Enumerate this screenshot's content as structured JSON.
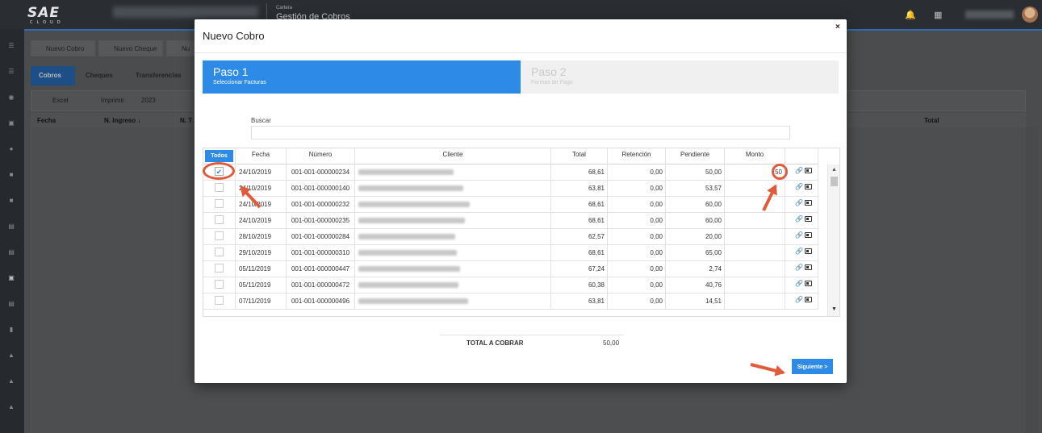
{
  "topbar": {
    "module": "Cartera",
    "title": "Gestión de Cobros"
  },
  "background": {
    "buttons": [
      "Nuevo Cobro",
      "Nuevo Cheque",
      "Nu"
    ],
    "tabs": [
      "Cobros",
      "Cheques",
      "Transferencias"
    ],
    "toolbar": {
      "excel": "Excel",
      "print": "Imprimir",
      "year": "2023"
    },
    "columns": [
      "Fecha",
      "N. Ingreso ↓",
      "N. T",
      "Total"
    ]
  },
  "modal": {
    "title": "Nuevo Cobro",
    "close": "×",
    "step1": {
      "title": "Paso 1",
      "subtitle": "Seleccionar Facturas"
    },
    "step2": {
      "title": "Paso 2",
      "subtitle": "Formas de Pago"
    },
    "search_label": "Buscar",
    "search_value": "",
    "table": {
      "todos": "Todos",
      "headers": {
        "fecha": "Fecha",
        "numero": "Número",
        "cliente": "Cliente",
        "total": "Total",
        "retencion": "Retención",
        "pendiente": "Pendiente",
        "monto": "Monto"
      },
      "rows": [
        {
          "fecha": "24/10/2019",
          "numero": "001-001-000000234",
          "total": "68,61",
          "retencion": "0,00",
          "pendiente": "50,00",
          "monto": "50",
          "checked": true
        },
        {
          "fecha": "24/10/2019",
          "numero": "001-001-000000140",
          "total": "63,81",
          "retencion": "0,00",
          "pendiente": "53,57",
          "monto": "",
          "checked": false
        },
        {
          "fecha": "24/10/2019",
          "numero": "001-001-000000232",
          "total": "68,61",
          "retencion": "0,00",
          "pendiente": "60,00",
          "monto": "",
          "checked": false
        },
        {
          "fecha": "24/10/2019",
          "numero": "001-001-000000235",
          "total": "68,61",
          "retencion": "0,00",
          "pendiente": "60,00",
          "monto": "",
          "checked": false
        },
        {
          "fecha": "28/10/2019",
          "numero": "001-001-000000284",
          "total": "62,57",
          "retencion": "0,00",
          "pendiente": "20,00",
          "monto": "",
          "checked": false
        },
        {
          "fecha": "29/10/2019",
          "numero": "001-001-000000310",
          "total": "68,61",
          "retencion": "0,00",
          "pendiente": "65,00",
          "monto": "",
          "checked": false
        },
        {
          "fecha": "05/11/2019",
          "numero": "001-001-000000447",
          "total": "67,24",
          "retencion": "0,00",
          "pendiente": "2,74",
          "monto": "",
          "checked": false
        },
        {
          "fecha": "05/11/2019",
          "numero": "001-001-000000472",
          "total": "60,38",
          "retencion": "0,00",
          "pendiente": "40,76",
          "monto": "",
          "checked": false
        },
        {
          "fecha": "07/11/2019",
          "numero": "001-001-000000496",
          "total": "63,81",
          "retencion": "0,00",
          "pendiente": "14,51",
          "monto": "",
          "checked": false
        }
      ]
    },
    "total_label": "TOTAL A COBRAR",
    "total_value": "50,00",
    "next_button": "Siguiente >"
  },
  "colors": {
    "primary": "#2d8be7",
    "annotation": "#e25a3c"
  },
  "icons": [
    "calculator-icon",
    "link-icon",
    "id-card-icon",
    "bell-icon",
    "grid-icon",
    "close-icon"
  ]
}
